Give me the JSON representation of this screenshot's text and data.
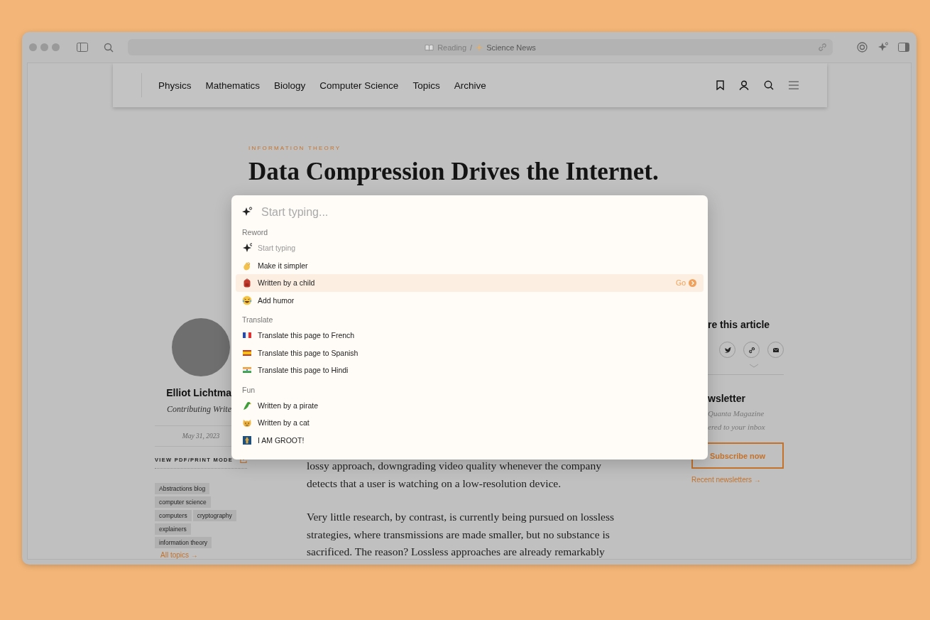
{
  "browser": {
    "address": {
      "section": "Reading",
      "separator": "/",
      "site": "Science News"
    }
  },
  "nav": {
    "links": [
      "Physics",
      "Mathematics",
      "Biology",
      "Computer Science",
      "Topics",
      "Archive"
    ]
  },
  "article": {
    "category": "INFORMATION THEORY",
    "title": "Data Compression Drives the Internet.",
    "body": [
      "lossy approach, downgrading video quality whenever the company detects that a user is watching on a low-resolution device.",
      "Very little research, by contrast, is currently being pursued on lossless strategies, where transmissions are made smaller, but no substance is sacrificed. The reason? Lossless approaches are already remarkably"
    ]
  },
  "author": {
    "name": "Elliot Lichtma",
    "role": "Contributing Write",
    "date": "May 31, 2023"
  },
  "pdf_link": "VIEW PDF/PRINT MODE",
  "tags": [
    "Abstractions blog",
    "computer science",
    "computers",
    "cryptography",
    "explainers",
    "information theory"
  ],
  "all_topics": "All topics →",
  "share": {
    "heading": "re this article"
  },
  "newsletter": {
    "heading": "wsletter",
    "lines": [
      "Quanta Magazine",
      "ered to your inbox"
    ],
    "button": "Subscribe now",
    "link": "Recent newsletters →"
  },
  "palette": {
    "placeholder": "Start typing...",
    "action": "Go",
    "sections": [
      {
        "title": "Reword",
        "items": [
          {
            "label": "Start typing",
            "disabled": true,
            "selected": false
          },
          {
            "label": "Make it simpler",
            "disabled": false,
            "selected": false
          },
          {
            "label": "Written by a child",
            "disabled": false,
            "selected": true
          },
          {
            "label": "Add humor",
            "disabled": false,
            "selected": false
          }
        ]
      },
      {
        "title": "Translate",
        "items": [
          {
            "label": "Translate this page to French",
            "disabled": false,
            "selected": false
          },
          {
            "label": "Translate this page to Spanish",
            "disabled": false,
            "selected": false
          },
          {
            "label": "Translate this page to Hindi",
            "disabled": false,
            "selected": false
          }
        ]
      },
      {
        "title": "Fun",
        "items": [
          {
            "label": "Written by a pirate",
            "disabled": false,
            "selected": false
          },
          {
            "label": "Written by a cat",
            "disabled": false,
            "selected": false
          },
          {
            "label": "I AM GROOT!",
            "disabled": false,
            "selected": false
          }
        ]
      }
    ]
  }
}
